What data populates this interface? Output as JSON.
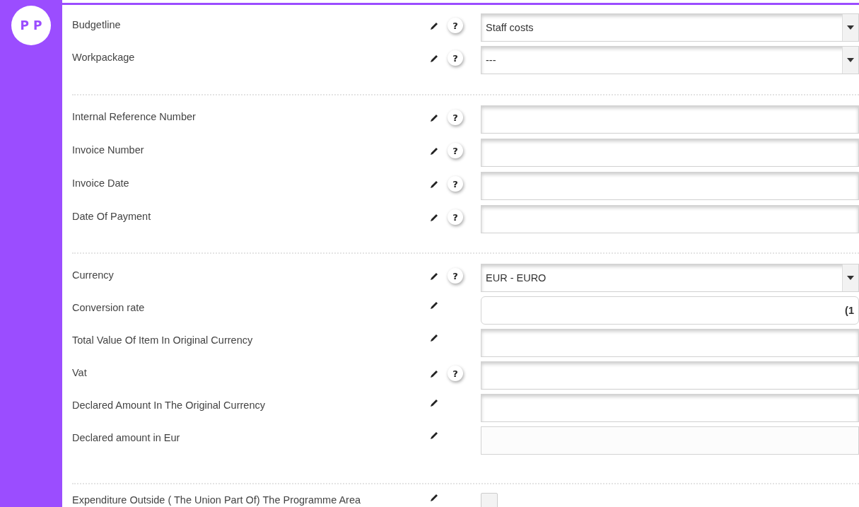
{
  "avatar": {
    "initials": "P P"
  },
  "groups": [
    {
      "rows": [
        {
          "label": "Budgetline",
          "kind": "select",
          "help": "?",
          "value": "Staff costs"
        },
        {
          "label": "Workpackage",
          "kind": "select",
          "help": "?",
          "value": "---"
        }
      ]
    },
    {
      "rows": [
        {
          "label": "Internal Reference Number",
          "kind": "text",
          "help": "?"
        },
        {
          "label": "Invoice Number",
          "kind": "text",
          "help": "?"
        },
        {
          "label": "Invoice Date",
          "kind": "text",
          "help": "?"
        },
        {
          "label": "Date Of Payment",
          "kind": "text",
          "help": "?"
        }
      ]
    },
    {
      "rows": [
        {
          "label": "Currency",
          "kind": "select",
          "help": "?",
          "value": "EUR - EURO"
        },
        {
          "label": "Conversion rate",
          "kind": "rounded",
          "value": "(1"
        },
        {
          "label": "Total Value Of Item In Original Currency",
          "kind": "text"
        },
        {
          "label": "Vat",
          "kind": "text",
          "help": "?"
        },
        {
          "label": "Declared Amount In The Original Currency",
          "kind": "text"
        },
        {
          "label": "Declared amount in Eur",
          "kind": "readonly"
        }
      ]
    },
    {
      "rows": [
        {
          "label": "Expenditure Outside ( The Union Part Of) The Programme Area",
          "kind": "checkbox",
          "checked": false
        }
      ]
    }
  ]
}
